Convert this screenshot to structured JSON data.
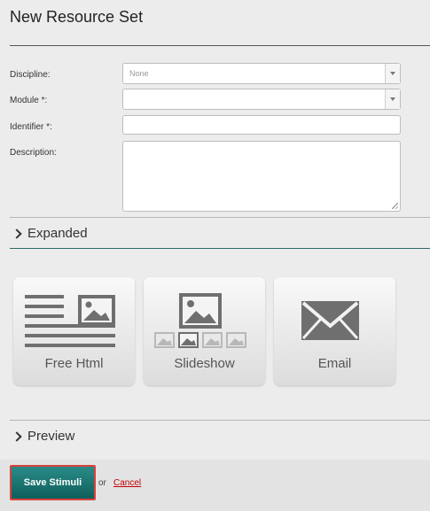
{
  "page": {
    "title": "New Resource Set"
  },
  "form": {
    "discipline": {
      "label": "Discipline:",
      "value": "None"
    },
    "module": {
      "label": "Module *:",
      "value": ""
    },
    "identifier": {
      "label": "Identifier *:",
      "value": ""
    },
    "description": {
      "label": "Description:",
      "value": ""
    }
  },
  "sections": {
    "expanded": "Expanded",
    "preview": "Preview"
  },
  "tiles": [
    {
      "label": "Free Html",
      "icon": "free-html-icon"
    },
    {
      "label": "Slideshow",
      "icon": "slideshow-icon"
    },
    {
      "label": "Email",
      "icon": "email-icon"
    }
  ],
  "actions": {
    "save_label": "Save Stimuli",
    "or_text": "or",
    "cancel_label": "Cancel"
  },
  "colors": {
    "accent": "#1a7370",
    "save_border": "#d9413c",
    "cancel": "#c00000",
    "icon_gray": "#6f6f6f"
  }
}
